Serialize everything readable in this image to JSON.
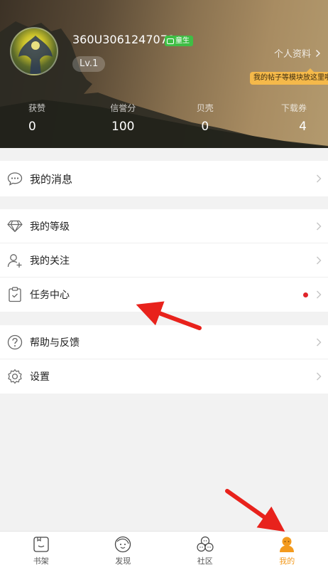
{
  "profile": {
    "username": "360U3061247078",
    "badge": "童生",
    "level": "Lv.1",
    "profile_link": "个人资料",
    "tip": "我的帖子等模块放这里啦"
  },
  "stats": [
    {
      "label": "获赞",
      "value": "0"
    },
    {
      "label": "信誉分",
      "value": "100"
    },
    {
      "label": "贝壳",
      "value": "0"
    },
    {
      "label": "下载券",
      "value": "4"
    }
  ],
  "menu": {
    "messages": "我的消息",
    "level": "我的等级",
    "follow": "我的关注",
    "tasks": "任务中心",
    "help": "帮助与反馈",
    "settings": "设置"
  },
  "nav": [
    {
      "label": "书架",
      "icon": "bookshelf-icon"
    },
    {
      "label": "发现",
      "icon": "discover-icon"
    },
    {
      "label": "社区",
      "icon": "community-icon"
    },
    {
      "label": "我的",
      "icon": "me-icon"
    }
  ],
  "colors": {
    "accent": "#f39a1e",
    "badge": "#3fbe45",
    "notice_dot": "#e0242a",
    "annotation_arrow": "#e8221c"
  }
}
